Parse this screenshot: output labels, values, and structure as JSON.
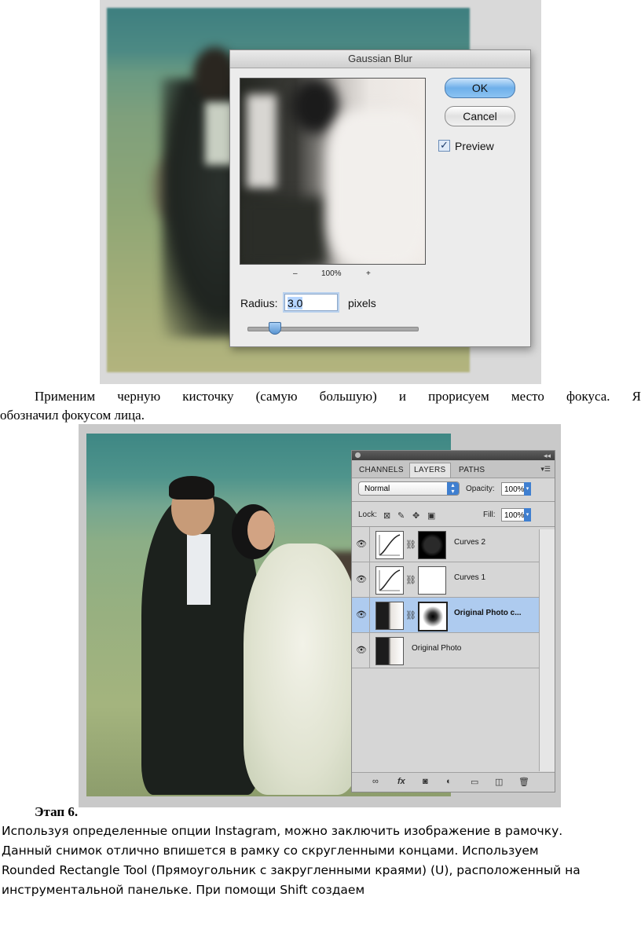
{
  "dialog": {
    "title": "Gaussian Blur",
    "ok_label": "OK",
    "cancel_label": "Cancel",
    "preview_label": "Preview",
    "preview_checked": true,
    "zoom_minus": "–",
    "zoom_level": "100%",
    "zoom_plus": "+",
    "radius_label": "Radius:",
    "radius_value": "3.0",
    "radius_unit": "pixels"
  },
  "paragraph1": {
    "line1": "Применим черную кисточку (самую большую) и прорисуем место фокуса. Я",
    "line2": "обозначил фокусом лица."
  },
  "layers_panel": {
    "tabs": [
      "CHANNELS",
      "LAYERS",
      "PATHS"
    ],
    "active_tab": "LAYERS",
    "blend_mode": "Normal",
    "opacity_label": "Opacity:",
    "opacity_value": "100%",
    "lock_label": "Lock:",
    "fill_label": "Fill:",
    "fill_value": "100%",
    "layers": [
      {
        "name": "Curves 2",
        "type": "adjustment",
        "mask": "black",
        "selected": false
      },
      {
        "name": "Curves 1",
        "type": "adjustment",
        "mask": "white",
        "selected": false
      },
      {
        "name": "Original Photo c...",
        "type": "photo",
        "mask": "spot",
        "selected": true
      },
      {
        "name": "Original Photo",
        "type": "photo",
        "mask": "none",
        "selected": false
      }
    ]
  },
  "stage_heading": "Этап 6.",
  "paragraph2": {
    "line1": "Используя определенные опции Instagram, можно заключить изображение в рамочку.",
    "line2": "Данный снимок отлично впишется в рамку со скругленными концами. Используем",
    "line3": "Rounded Rectangle Tool (Прямоугольник с закругленными краями) (U), расположенный на",
    "line4": "инструментальной панельке. При помощи Shift создаем"
  }
}
